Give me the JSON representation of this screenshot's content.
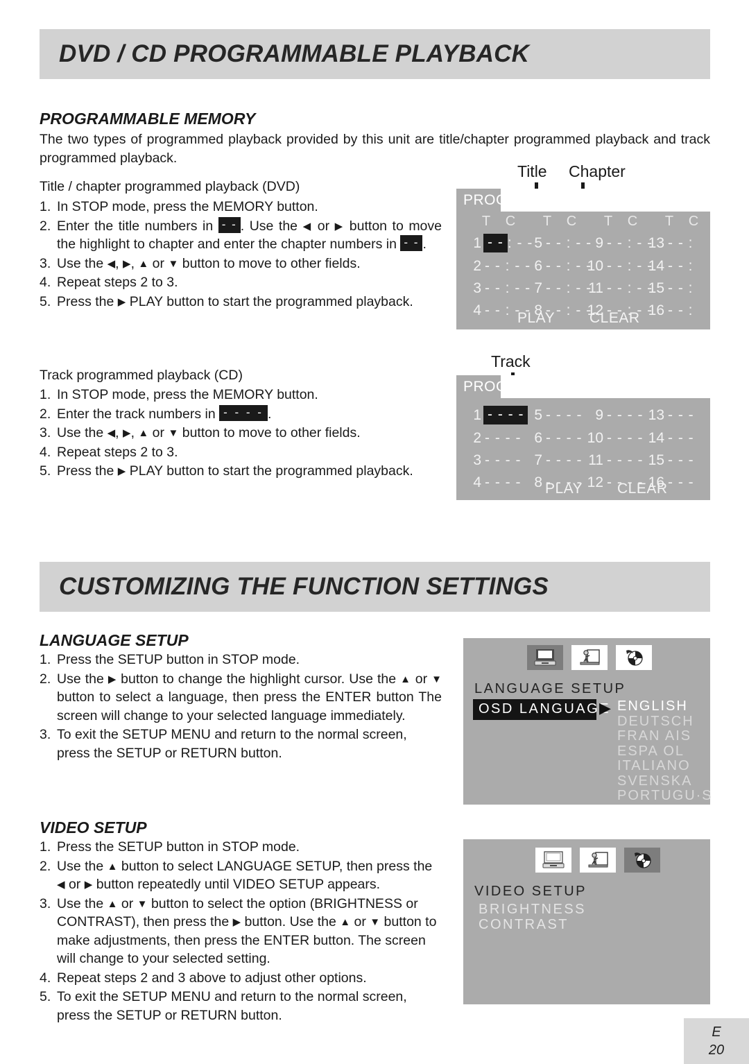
{
  "section1": {
    "banner_title": "DVD / CD PROGRAMMABLE PLAYBACK",
    "heading": "PROGRAMMABLE MEMORY",
    "intro": "The two types of programmed playback provided by this unit are title/chapter programmed playback and track programmed playback.",
    "dvd": {
      "caption": "Title / chapter programmed playback (DVD)",
      "steps": [
        {
          "num": "1.",
          "text_a": "In STOP mode, press the MEMORY button."
        },
        {
          "num": "2.",
          "text_a": "Enter the title numbers in ",
          "box_a": "- -",
          "text_b": ". Use the ",
          "arrow_a": "◀",
          "text_c": " or ",
          "arrow_b": "▶",
          "text_d": " button to move the highlight to chapter and enter the chapter numbers in ",
          "box_b": "- -",
          "text_e": "."
        },
        {
          "num": "3.",
          "text_a": "Use the ",
          "arrow_a": "◀",
          "text_b": ", ",
          "arrow_b": "▶",
          "text_c": ", ",
          "arrow_c": "▲",
          "text_d": " or ",
          "arrow_d": "▼",
          "text_e": " button to move to other fields."
        },
        {
          "num": "4.",
          "text_a": "Repeat steps 2 to 3."
        },
        {
          "num": "5.",
          "text_a": "Press the ",
          "arrow_a": "▶",
          "text_b": " PLAY button to start the programmed playback."
        }
      ]
    },
    "cd": {
      "caption": "Track programmed playback (CD)",
      "steps": [
        {
          "num": "1.",
          "text_a": "In STOP mode, press the MEMORY button."
        },
        {
          "num": "2.",
          "text_a": "Enter the track numbers in ",
          "box_a": "- - - -",
          "text_b": "."
        },
        {
          "num": "3.",
          "text_a": "Use the ",
          "arrow_a": "◀",
          "text_b": ", ",
          "arrow_b": "▶",
          "text_c": ", ",
          "arrow_c": "▲",
          "text_d": " or ",
          "arrow_d": "▼",
          "text_e": " button to move to other fields."
        },
        {
          "num": "4.",
          "text_a": "Repeat steps 2 to 3."
        },
        {
          "num": "5.",
          "text_a": "Press the ",
          "arrow_a": "▶",
          "text_b": " PLAY button to start the programmed playback."
        }
      ]
    }
  },
  "dvd_prog_screen": {
    "prog_label": "PROG",
    "leader_title": "Title",
    "leader_chapter": "Chapter",
    "col_headers": [
      "T",
      "C",
      "T",
      "C",
      "T",
      "C",
      "T",
      "C"
    ],
    "rows": [
      [
        {
          "idx": "1",
          "val": "- -",
          "highlight": true
        },
        {
          "idx": "1b",
          "val": ": - -",
          "plain": true
        },
        {
          "idx": "5",
          "val": "- - : - -"
        },
        {
          "idx": "9",
          "val": "- - : - -"
        },
        {
          "idx": "13",
          "val": "- - :"
        }
      ],
      [
        {
          "idx": "2",
          "val": "- - : - -"
        },
        {
          "idx": "6",
          "val": "- - : - -"
        },
        {
          "idx": "10",
          "val": "- - : - -"
        },
        {
          "idx": "14",
          "val": "- - :"
        }
      ],
      [
        {
          "idx": "3",
          "val": "- - : - -"
        },
        {
          "idx": "7",
          "val": "- - : - -"
        },
        {
          "idx": "11",
          "val": "- - : - -"
        },
        {
          "idx": "15",
          "val": "- - :"
        }
      ],
      [
        {
          "idx": "4",
          "val": "- - : - -"
        },
        {
          "idx": "8",
          "val": "- - : - -"
        },
        {
          "idx": "12",
          "val": "- - : - -"
        },
        {
          "idx": "16",
          "val": "- - :"
        }
      ]
    ],
    "play_label": "PLAY",
    "clear_label": "CLEAR"
  },
  "cd_prog_screen": {
    "prog_label": "PROG",
    "leader_track": "Track",
    "rows": [
      [
        {
          "idx": "1",
          "val": "- - - -",
          "highlight": true
        },
        {
          "idx": "5",
          "val": "- - - -"
        },
        {
          "idx": "9",
          "val": "- - - -"
        },
        {
          "idx": "13",
          "val": "- - -"
        }
      ],
      [
        {
          "idx": "2",
          "val": "- - - -"
        },
        {
          "idx": "6",
          "val": "- - - -"
        },
        {
          "idx": "10",
          "val": "- - - -"
        },
        {
          "idx": "14",
          "val": "- - -"
        }
      ],
      [
        {
          "idx": "3",
          "val": "- - - -"
        },
        {
          "idx": "7",
          "val": "- - - -"
        },
        {
          "idx": "11",
          "val": "- - - -"
        },
        {
          "idx": "15",
          "val": "- - -"
        }
      ],
      [
        {
          "idx": "4",
          "val": "- - - -"
        },
        {
          "idx": "8",
          "val": "- - - -"
        },
        {
          "idx": "12",
          "val": "- - - -"
        },
        {
          "idx": "16",
          "val": "- - -"
        }
      ]
    ],
    "play_label": "PLAY",
    "clear_label": "CLEAR"
  },
  "section2": {
    "banner_title": "CUSTOMIZING THE FUNCTION SETTINGS",
    "language": {
      "heading": "LANGUAGE SETUP",
      "steps": [
        {
          "num": "1.",
          "text_a": "Press the SETUP button in STOP mode."
        },
        {
          "num": "2.",
          "text_a": "Use the ",
          "arrow_a": "▶",
          "text_b": " button to change the highlight cursor. Use the ",
          "arrow_b": "▲",
          "text_c": " or ",
          "arrow_c": "▼",
          "text_d": " button to select a language, then press the ENTER button The screen will change to your selected language immediately."
        },
        {
          "num": "3.",
          "text_a": "To exit the SETUP MENU and return to the normal screen, press the SETUP or RETURN button."
        }
      ]
    },
    "video": {
      "heading": "VIDEO SETUP",
      "steps": [
        {
          "num": "1.",
          "text_a": "Press the SETUP button in STOP mode."
        },
        {
          "num": "2.",
          "text_a": "Use the ",
          "arrow_a": "▲",
          "text_b": " button to select LANGUAGE SETUP, then press the ",
          "arrow_b": "◀",
          "text_c": " or ",
          "arrow_c": "▶",
          "text_d": " button repeatedly until VIDEO SETUP appears."
        },
        {
          "num": "3.",
          "text_a": "Use the ",
          "arrow_a": "▲",
          "text_b": " or ",
          "arrow_b": "▼",
          "text_c": " button to select the option (BRIGHTNESS or CONTRAST), then press the ",
          "arrow_c": "▶",
          "text_d": " button. Use the ",
          "arrow_d": "▲",
          "text_e": " or ",
          "arrow_e": "▼",
          "text_f": " button to make adjustments, then press the ENTER button. The screen will change to your selected setting."
        },
        {
          "num": "4.",
          "text_a": "Repeat steps 2 and 3 above to adjust other options."
        },
        {
          "num": "5.",
          "text_a": "To exit the SETUP MENU and return to the normal screen, press the SETUP or RETURN button."
        }
      ]
    }
  },
  "language_setup_screen": {
    "icons": [
      {
        "name": "monitor-icon",
        "selected": true
      },
      {
        "name": "person-screen-icon",
        "selected": false
      },
      {
        "name": "disc-icon",
        "selected": false
      }
    ],
    "title": "LANGUAGE SETUP",
    "selected_item": "OSD LANGUAGE",
    "cursor_arrow": "▶",
    "languages": [
      "ENGLISH",
      "DEUTSCH",
      "FRAN AIS",
      "ESPA OL",
      "ITALIANO",
      "SVENSKA",
      "PORTUGU·S"
    ],
    "current_language": "ENGLISH"
  },
  "video_setup_screen": {
    "icons": [
      {
        "name": "monitor-icon",
        "selected": false
      },
      {
        "name": "person-screen-icon",
        "selected": false
      },
      {
        "name": "disc-icon",
        "selected": true
      }
    ],
    "title": "VIDEO SETUP",
    "options": [
      "BRIGHTNESS",
      "CONTRAST"
    ]
  },
  "footer": {
    "lang_code": "E",
    "page_number": "20"
  }
}
